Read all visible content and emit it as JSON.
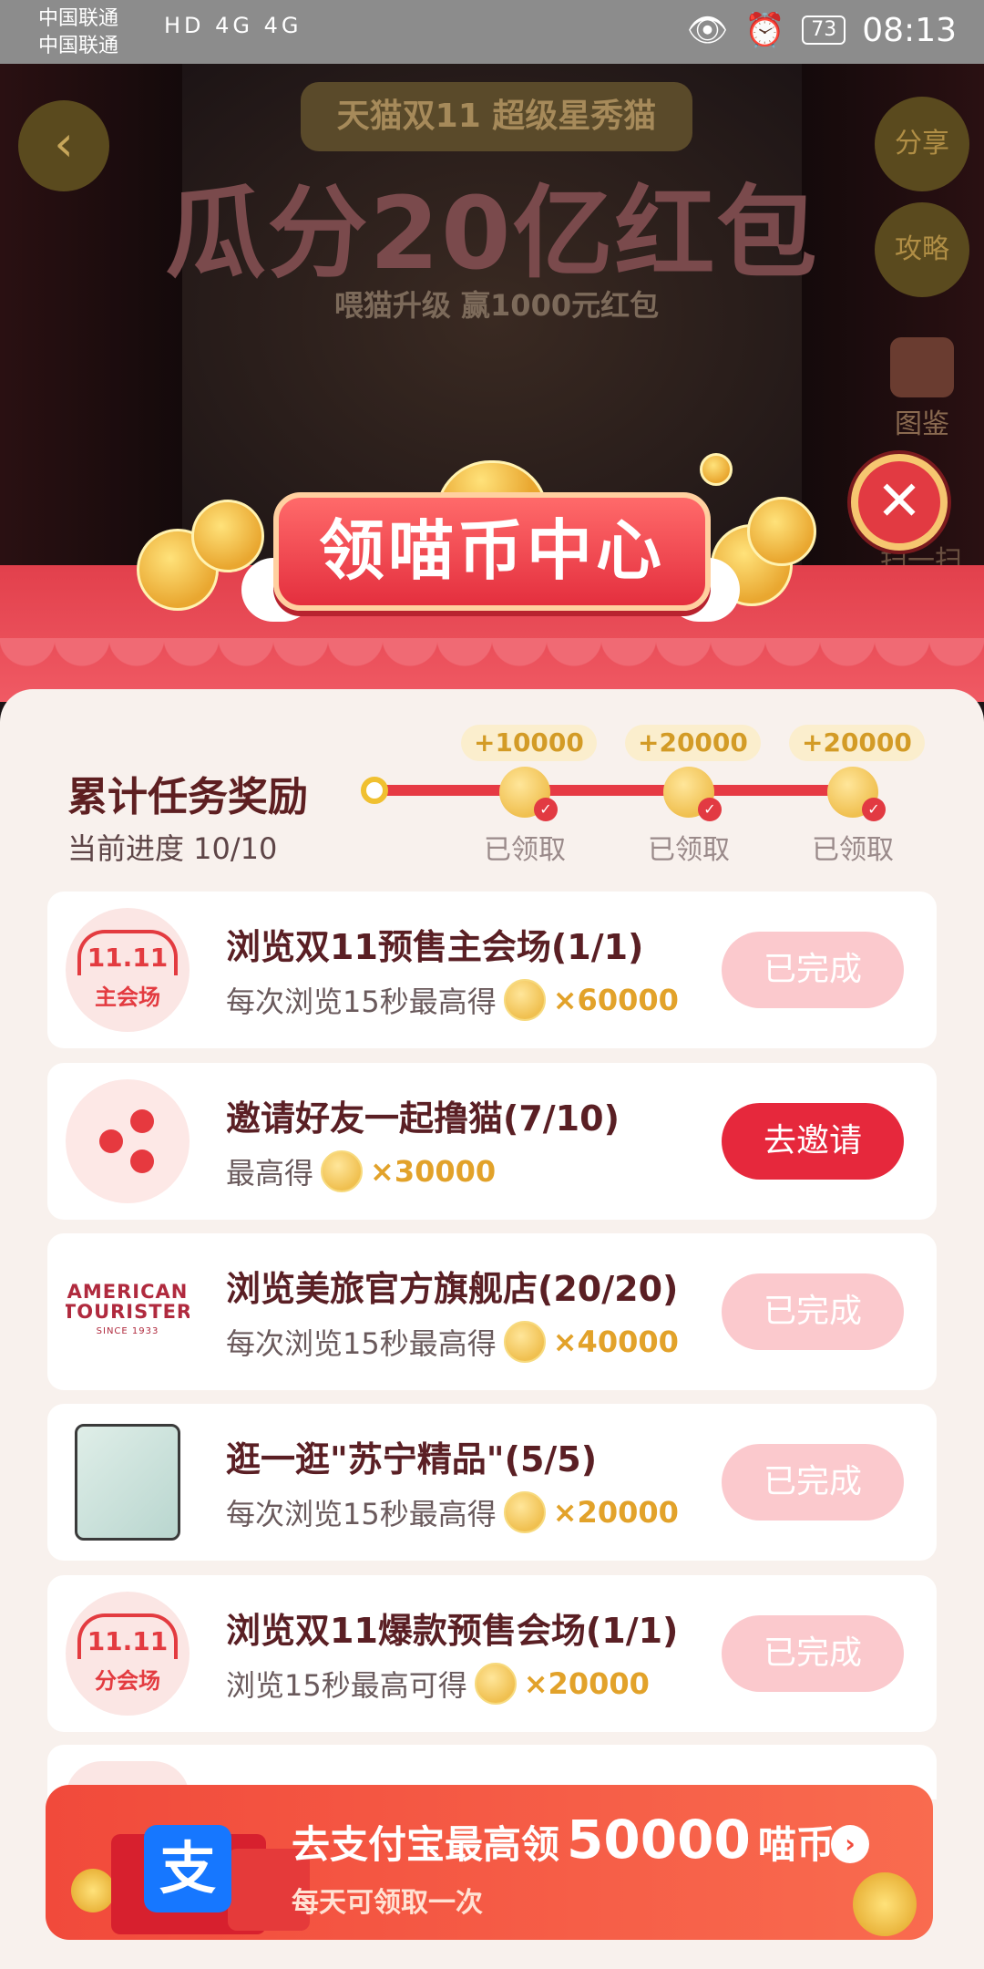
{
  "status_bar": {
    "carrier_1": "中国联通",
    "carrier_2": "中国联通",
    "net_icons": "HD 4G 4G",
    "battery": "73",
    "time": "08:13"
  },
  "background": {
    "banner_top": "天猫双11 超级星秀猫",
    "banner_big": "瓜分20亿红包",
    "banner_sub": "喂猫升级 赢1000元红包",
    "share_btn": "分享",
    "guide_btn": "攻略",
    "tujian_btn": "图鉴",
    "scan_btn": "扫一扫"
  },
  "header": {
    "title": "领喵币中心"
  },
  "progress": {
    "title": "累计任务奖励",
    "current": "当前进度 10/10",
    "milestones": [
      {
        "amount": "+10000",
        "label": "已领取"
      },
      {
        "amount": "+20000",
        "label": "已领取"
      },
      {
        "amount": "+20000",
        "label": "已领取"
      }
    ]
  },
  "tasks": [
    {
      "thumb_logo": "11.11",
      "thumb_tag": "主会场",
      "title": "浏览双11预售主会场(1/1)",
      "desc": "每次浏览15秒最高得",
      "amount": "×60000",
      "button": "已完成"
    },
    {
      "thumb_icon": "share-icon",
      "title": "邀请好友一起撸猫(7/10)",
      "desc": "最高得",
      "amount": "×30000",
      "button": "去邀请"
    },
    {
      "thumb_logo": "AMERICAN TOURISTER",
      "thumb_small": "SINCE 1933",
      "title": "浏览美旅官方旗舰店(20/20)",
      "desc": "每次浏览15秒最高得",
      "amount": "×40000",
      "button": "已完成"
    },
    {
      "thumb_icon": "phone-product-image",
      "title": "逛一逛\"苏宁精品\"(5/5)",
      "desc": "每次浏览15秒最高得",
      "amount": "×20000",
      "button": "已完成"
    },
    {
      "thumb_logo": "11.11",
      "thumb_tag": "分会场",
      "title": "浏览双11爆款预售会场(1/1)",
      "desc": "浏览15秒最高可得",
      "amount": "×20000",
      "button": "已完成"
    }
  ],
  "alipay_banner": {
    "logo": "支",
    "title_prefix": "去支付宝最高领",
    "title_amount": "50000",
    "title_suffix": "喵币",
    "sub": "每天可领取一次"
  },
  "colors": {
    "accent_red": "#e6283c",
    "done_pink": "#fbc9cd",
    "coin_gold": "#e2a22a"
  }
}
